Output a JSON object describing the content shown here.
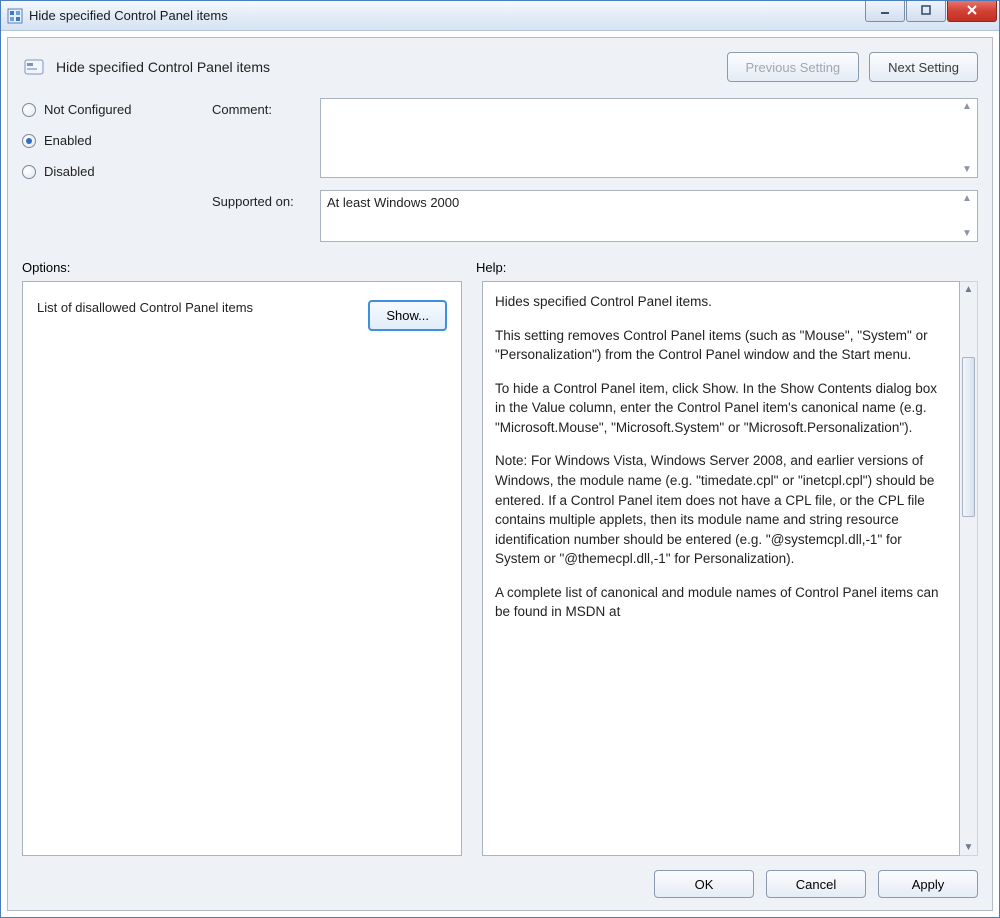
{
  "window": {
    "title": "Hide specified Control Panel items"
  },
  "header": {
    "title": "Hide specified Control Panel items",
    "prev_setting": "Previous Setting",
    "next_setting": "Next Setting"
  },
  "state": {
    "not_configured": "Not Configured",
    "enabled": "Enabled",
    "disabled": "Disabled",
    "selected": "enabled"
  },
  "fields": {
    "comment_label": "Comment:",
    "comment_value": "",
    "supported_label": "Supported on:",
    "supported_value": "At least Windows 2000"
  },
  "panels": {
    "options_label": "Options:",
    "help_label": "Help:"
  },
  "options": {
    "item_label": "List of disallowed Control Panel items",
    "show_button": "Show..."
  },
  "help": {
    "p1": "Hides specified Control Panel items.",
    "p2": "This setting removes Control Panel items (such as \"Mouse\", \"System\" or \"Personalization\") from the Control Panel window and the Start menu.",
    "p3": "To hide a Control Panel item, click Show. In the Show Contents dialog box in the Value column, enter the Control Panel item's canonical name (e.g. \"Microsoft.Mouse\", \"Microsoft.System\" or \"Microsoft.Personalization\").",
    "p4": "Note: For Windows Vista, Windows Server 2008, and earlier versions of Windows, the module name (e.g. \"timedate.cpl\" or \"inetcpl.cpl\") should be entered. If a Control Panel item does not have a CPL file, or the CPL file contains multiple applets, then its module name and string resource identification number should be entered (e.g. \"@systemcpl.dll,-1\" for System or \"@themecpl.dll,-1\" for Personalization).",
    "p5": "A complete list of canonical and module names of Control Panel items can be found in MSDN at"
  },
  "footer": {
    "ok": "OK",
    "cancel": "Cancel",
    "apply": "Apply"
  }
}
